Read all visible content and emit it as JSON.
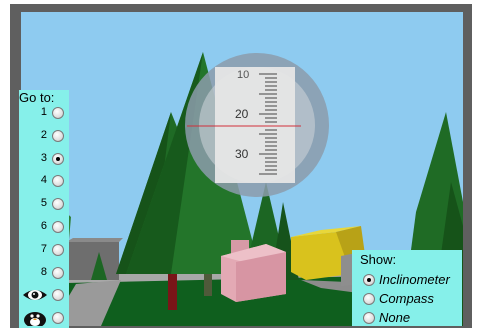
{
  "goto": {
    "title": "Go to:",
    "options": [
      {
        "label": "1",
        "selected": false
      },
      {
        "label": "2",
        "selected": false
      },
      {
        "label": "3",
        "selected": true
      },
      {
        "label": "4",
        "selected": false
      },
      {
        "label": "5",
        "selected": false
      },
      {
        "label": "6",
        "selected": false
      },
      {
        "label": "7",
        "selected": false
      },
      {
        "label": "8",
        "selected": false
      },
      {
        "label": "",
        "icon": "eye-icon",
        "selected": false
      },
      {
        "label": "",
        "icon": "penguin-icon",
        "selected": false
      }
    ]
  },
  "show": {
    "title": "Show:",
    "options": [
      {
        "label": "Inclinometer",
        "selected": true
      },
      {
        "label": "Compass",
        "selected": false
      },
      {
        "label": "None",
        "selected": false
      }
    ]
  },
  "inclinometer": {
    "scale_labels": [
      "10",
      "20",
      "30"
    ]
  },
  "colors": {
    "sky": "#8ecbf0",
    "ground": "#0f5f1e",
    "panel": "#86f0ea",
    "frame": "#5f5f5f",
    "tree": "#1f6b25",
    "pink_house": "#e3a9b4",
    "yellow_house": "#d9c21d"
  }
}
